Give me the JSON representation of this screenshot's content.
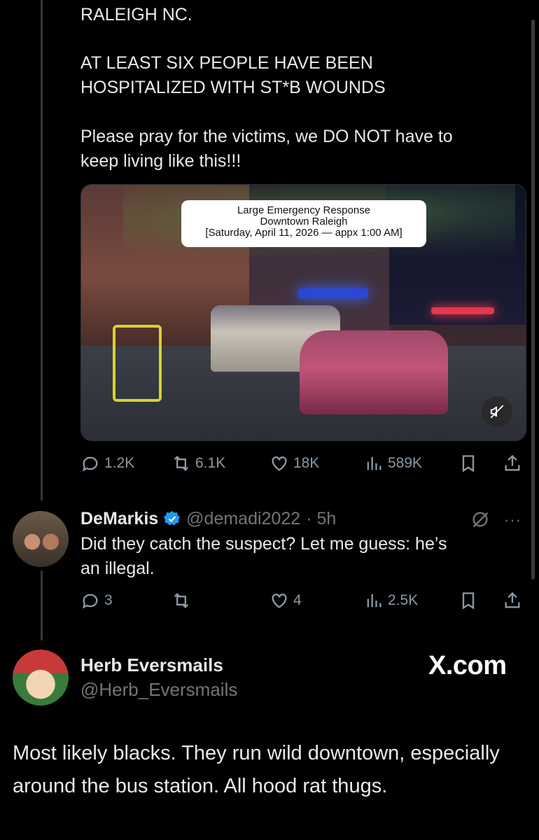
{
  "tweet": {
    "line1": "RALEIGH NC.",
    "line2": "AT LEAST SIX PEOPLE HAVE BEEN",
    "line3": "HOSPITALIZED WITH ST*B WOUNDS",
    "line4": "Please pray for the victims, we DO NOT have to",
    "line5": "keep living like this!!!",
    "media_caption": {
      "line1": "Large Emergency Response",
      "line2": "Downtown Raleigh",
      "line3": "[Saturday, April 11, 2026 — appx 1:00 AM]"
    },
    "stats": {
      "replies": "1.2K",
      "reposts": "6.1K",
      "likes": "18K",
      "views": "589K"
    }
  },
  "reply": {
    "name": "DeMarkis",
    "handle": "@demadi2022",
    "time": "· 5h",
    "text_line1": "Did they catch the suspect? Let me guess: he’s",
    "text_line2": "an illegal.",
    "more": "···",
    "stats": {
      "replies": "3",
      "reposts": "",
      "likes": "4",
      "views": "2.5K"
    }
  },
  "overlay_post": {
    "name": "Herb Eversmails",
    "handle": "@Herb_Eversmails",
    "brand": "X.com",
    "text": "Most likely blacks. They run wild downtown, especially around the bus station. All hood rat thugs."
  },
  "colors": {
    "background": "#000000",
    "text": "#e7e9ea",
    "muted": "#71767b",
    "verified": "#1d9bf0"
  }
}
